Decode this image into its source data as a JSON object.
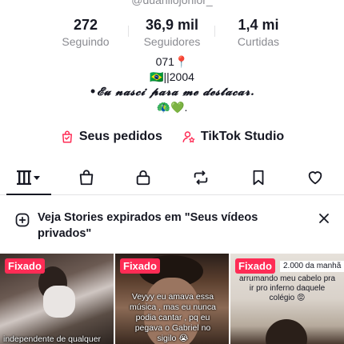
{
  "profile": {
    "handle": "@duanilojonior_"
  },
  "stats": [
    {
      "value": "272",
      "label": "Seguindo"
    },
    {
      "value": "36,9 mil",
      "label": "Seguidores"
    },
    {
      "value": "1,4 mi",
      "label": "Curtidas"
    }
  ],
  "bio": {
    "line1": "071📍",
    "line2": "🇧🇷||2004",
    "line3": "•𝓔𝓾 𝓷𝓪𝓼𝓬𝓲 𝓹𝓪𝓻𝓪 𝓶𝓮 𝓭𝓮𝓼𝓽𝓪𝓬𝓪𝓻.",
    "line4": "🦚💚."
  },
  "links": {
    "orders": "Seus pedidos",
    "studio": "TikTok Studio"
  },
  "tabs": [
    "videos-grid-icon",
    "shop-bag-icon",
    "lock-icon",
    "repost-icon",
    "bookmark-icon",
    "heart-icon"
  ],
  "banner": {
    "text": "Veja Stories expirados em \"Seus vídeos privados\""
  },
  "videos": [
    {
      "pinned": "Fixado",
      "caption": "independente de qualquer"
    },
    {
      "pinned": "Fixado",
      "caption": "Veyyy eu amava essa música , mas eu nunca podia cantar , pq eu pegava o Gabriel no sigilo 😭"
    },
    {
      "pinned": "Fixado",
      "caption_top": "2.000 da manhã",
      "caption": "arrumando meu cabelo pra ir pro inferno daquele colégio 😡"
    }
  ],
  "colors": {
    "accent": "#fe2c55",
    "text": "#161823",
    "muted": "#8a8b91"
  }
}
